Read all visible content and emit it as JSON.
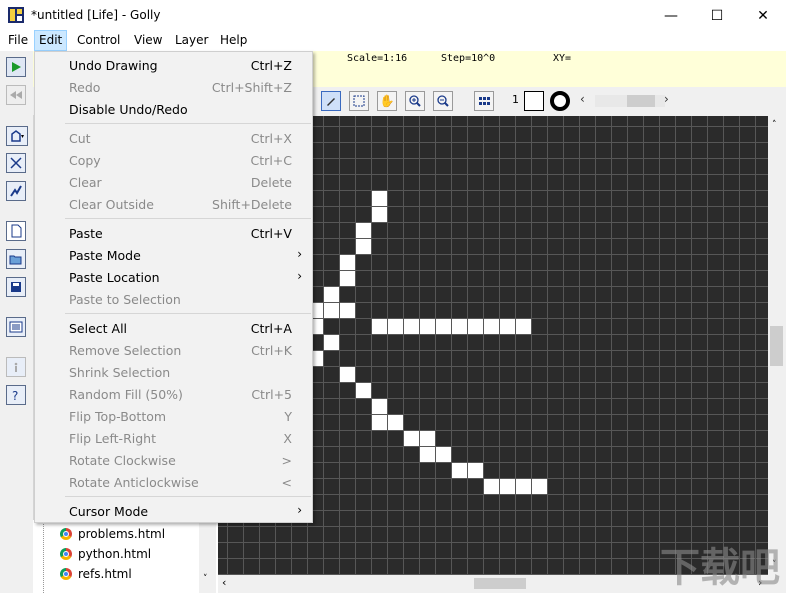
{
  "window": {
    "title": "*untitled [Life] - Golly",
    "minimize_glyph": "—",
    "maximize_glyph": "☐",
    "close_glyph": "✕"
  },
  "menubar": [
    "File",
    "Edit",
    "Control",
    "View",
    "Layer",
    "Help"
  ],
  "status": {
    "scale": "Scale=1:16",
    "step": "Step=10^0",
    "xy": "XY="
  },
  "toolbar2": {
    "state_label": "1"
  },
  "edit_menu": {
    "groups": [
      [
        {
          "label": "Undo Drawing",
          "shortcut": "Ctrl+Z",
          "enabled": true
        },
        {
          "label": "Redo",
          "shortcut": "Ctrl+Shift+Z",
          "enabled": false
        },
        {
          "label": "Disable Undo/Redo",
          "shortcut": "",
          "enabled": true
        }
      ],
      [
        {
          "label": "Cut",
          "shortcut": "Ctrl+X",
          "enabled": false
        },
        {
          "label": "Copy",
          "shortcut": "Ctrl+C",
          "enabled": false
        },
        {
          "label": "Clear",
          "shortcut": "Delete",
          "enabled": false
        },
        {
          "label": "Clear Outside",
          "shortcut": "Shift+Delete",
          "enabled": false
        }
      ],
      [
        {
          "label": "Paste",
          "shortcut": "Ctrl+V",
          "enabled": true
        },
        {
          "label": "Paste Mode",
          "shortcut": "",
          "enabled": true,
          "submenu": true
        },
        {
          "label": "Paste Location",
          "shortcut": "",
          "enabled": true,
          "submenu": true
        },
        {
          "label": "Paste to Selection",
          "shortcut": "",
          "enabled": false
        }
      ],
      [
        {
          "label": "Select All",
          "shortcut": "Ctrl+A",
          "enabled": true
        },
        {
          "label": "Remove Selection",
          "shortcut": "Ctrl+K",
          "enabled": false
        },
        {
          "label": "Shrink Selection",
          "shortcut": "",
          "enabled": false
        },
        {
          "label": "Random Fill (50%)",
          "shortcut": "Ctrl+5",
          "enabled": false
        },
        {
          "label": "Flip Top-Bottom",
          "shortcut": "Y",
          "enabled": false
        },
        {
          "label": "Flip Left-Right",
          "shortcut": "X",
          "enabled": false
        },
        {
          "label": "Rotate Clockwise",
          "shortcut": ">",
          "enabled": false
        },
        {
          "label": "Rotate Anticlockwise",
          "shortcut": "<",
          "enabled": false
        }
      ],
      [
        {
          "label": "Cursor Mode",
          "shortcut": "",
          "enabled": true,
          "submenu": true
        }
      ]
    ],
    "submenu_arrow": "›"
  },
  "file_tree": [
    "problems.html",
    "python.html",
    "refs.html"
  ],
  "watermark": "下载吧",
  "colors": {
    "grid_bg": "#2b2b2b",
    "grid_line": "#575757",
    "cell": "#ffffff",
    "menu_highlight": "#cce8ff",
    "status_bg": "#ffffd9"
  }
}
